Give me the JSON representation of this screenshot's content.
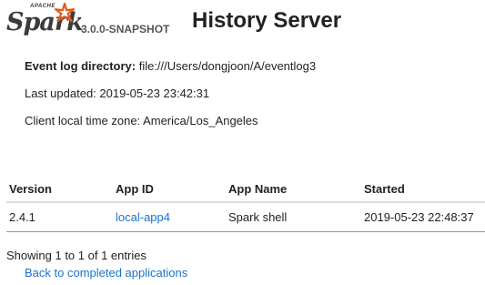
{
  "header": {
    "logo_text": "Spark",
    "logo_apache": "APACHE",
    "version": "3.0.0-SNAPSHOT",
    "title": "History Server"
  },
  "info": {
    "event_log_label": "Event log directory:",
    "event_log_value": "file:///Users/dongjoon/A/eventlog3",
    "last_updated": "Last updated: 2019-05-23 23:42:31",
    "time_zone": "Client local time zone: America/Los_Angeles"
  },
  "table": {
    "headers": [
      "Version",
      "App ID",
      "App Name",
      "Started"
    ],
    "rows": [
      {
        "version": "2.4.1",
        "app_id": "local-app4",
        "app_name": "Spark shell",
        "started": "2019-05-23 22:48:37"
      }
    ]
  },
  "footer": {
    "entries": "Showing 1 to 1 of 1 entries",
    "back_link": "Back to completed applications"
  },
  "colors": {
    "link": "#1a73c8",
    "logo_star": "#e25a1c"
  }
}
